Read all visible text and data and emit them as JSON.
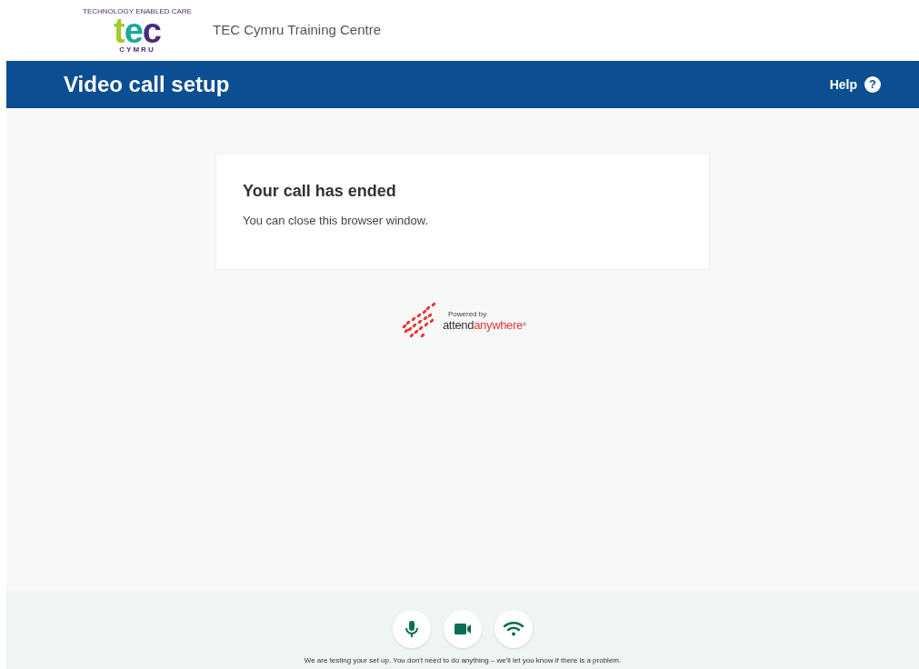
{
  "logo": {
    "tagline": "TECHNOLOGY ENABLED CARE",
    "letters": [
      {
        "text": "t",
        "color": "#a6c92e"
      },
      {
        "text": "e",
        "color": "#17a99c"
      },
      {
        "text": "c",
        "color": "#4b2a7b"
      }
    ],
    "sub": "CYMRU"
  },
  "site_title": "TEC Cymru Training Centre",
  "page_title": "Video call setup",
  "help": {
    "label": "Help",
    "icon": "?"
  },
  "card": {
    "title": "Your call has ended",
    "message": "You can close this browser window."
  },
  "powered_by": {
    "caption": "Powered by",
    "brand_dark": "attend",
    "brand_red": "anywhere",
    "mark": "®"
  },
  "footer": {
    "checks": [
      {
        "kind": "microphone"
      },
      {
        "kind": "camera"
      },
      {
        "kind": "network"
      }
    ],
    "message": "We are testing your set up. You don't need to do anything – we'll let you know if there is a problem."
  }
}
